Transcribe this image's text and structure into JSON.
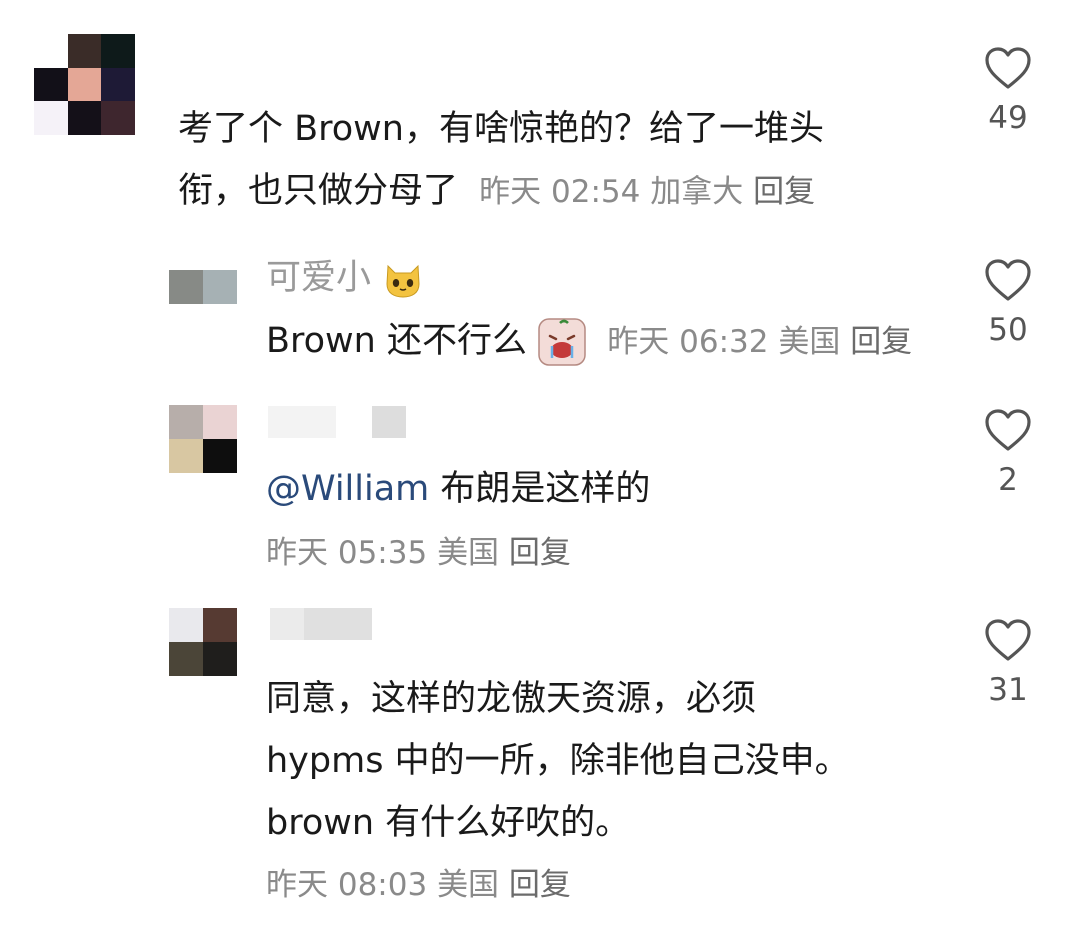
{
  "comments": [
    {
      "lines": [
        "考了个 Brown，有啥惊艳的？给了一堆头",
        "衔，也只做分母了"
      ],
      "time": "昨天 02:54",
      "location": "加拿大",
      "reply": "回复",
      "likes": "49",
      "avatar_colors": [
        "#ffffff",
        "#3a2c28",
        "#0e1a1a",
        "#121018",
        "#e4a796",
        "#1e1a36",
        "#f5f2f8",
        "#141018",
        "#3e262e"
      ]
    },
    {
      "username": "可爱小",
      "text": "Brown 还不行么",
      "time": "昨天 06:32",
      "location": "美国",
      "reply": "回复",
      "likes": "50",
      "avatar_colors": [
        "#ffffff",
        "#ffffff",
        "#878a86",
        "#a6b1b4"
      ]
    },
    {
      "mention": "@William",
      "text": "布朗是这样的",
      "time": "昨天 05:35",
      "location": "美国",
      "reply": "回复",
      "likes": "2",
      "avatar_colors": [
        "#b7aeaa",
        "#ead3d3",
        "#d8c7a2",
        "#0e0e0e"
      ]
    },
    {
      "lines": [
        "同意，这样的龙傲天资源，必须",
        "hypms 中的一所，除非他自己没申。",
        "brown 有什么好吹的。"
      ],
      "time": "昨天 08:03",
      "location": "美国",
      "reply": "回复",
      "likes": "31",
      "avatar_colors": [
        "#e9e9ed",
        "#563a32",
        "#4b4538",
        "#1f1e1c"
      ]
    }
  ],
  "icons": {
    "like": "heart-outline-icon",
    "cat": "cat-emoji-icon",
    "cry": "crying-face-emoji-icon"
  },
  "colors": {
    "mention": "#2a4a7a",
    "meta": "#8a8a8a",
    "text": "#1a1a1a"
  }
}
